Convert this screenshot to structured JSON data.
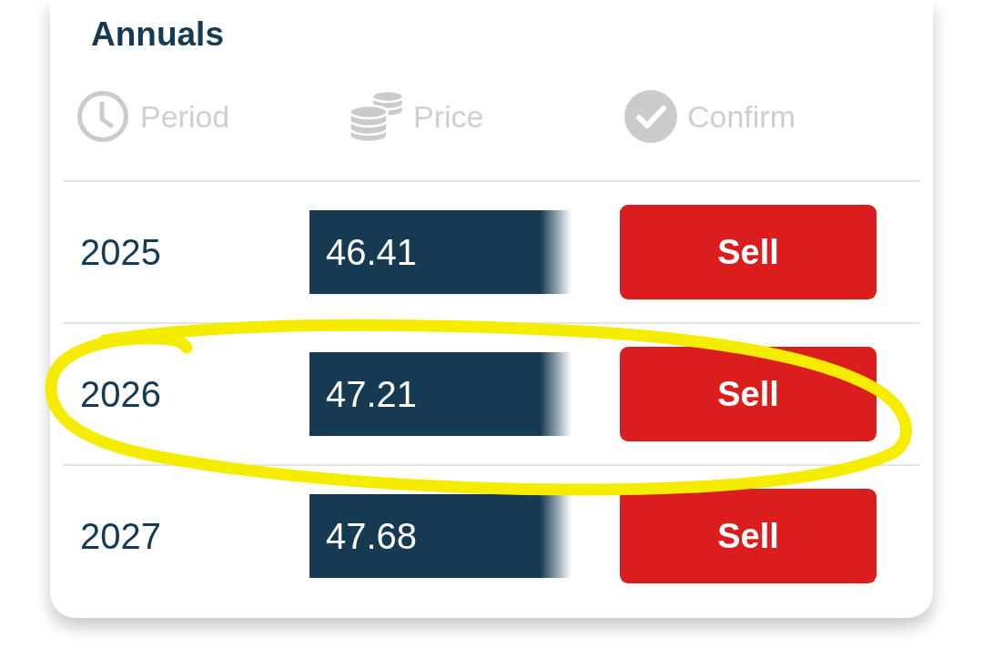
{
  "card": {
    "title": "Annuals"
  },
  "columns": [
    {
      "label": "Period"
    },
    {
      "label": "Price"
    },
    {
      "label": "Confirm"
    }
  ],
  "rows": [
    {
      "period": "2025",
      "price": "46.41",
      "action": "Sell",
      "circled": false
    },
    {
      "period": "2026",
      "price": "47.21",
      "action": "Sell",
      "circled": true
    },
    {
      "period": "2027",
      "price": "47.68",
      "action": "Sell",
      "circled": false
    }
  ]
}
